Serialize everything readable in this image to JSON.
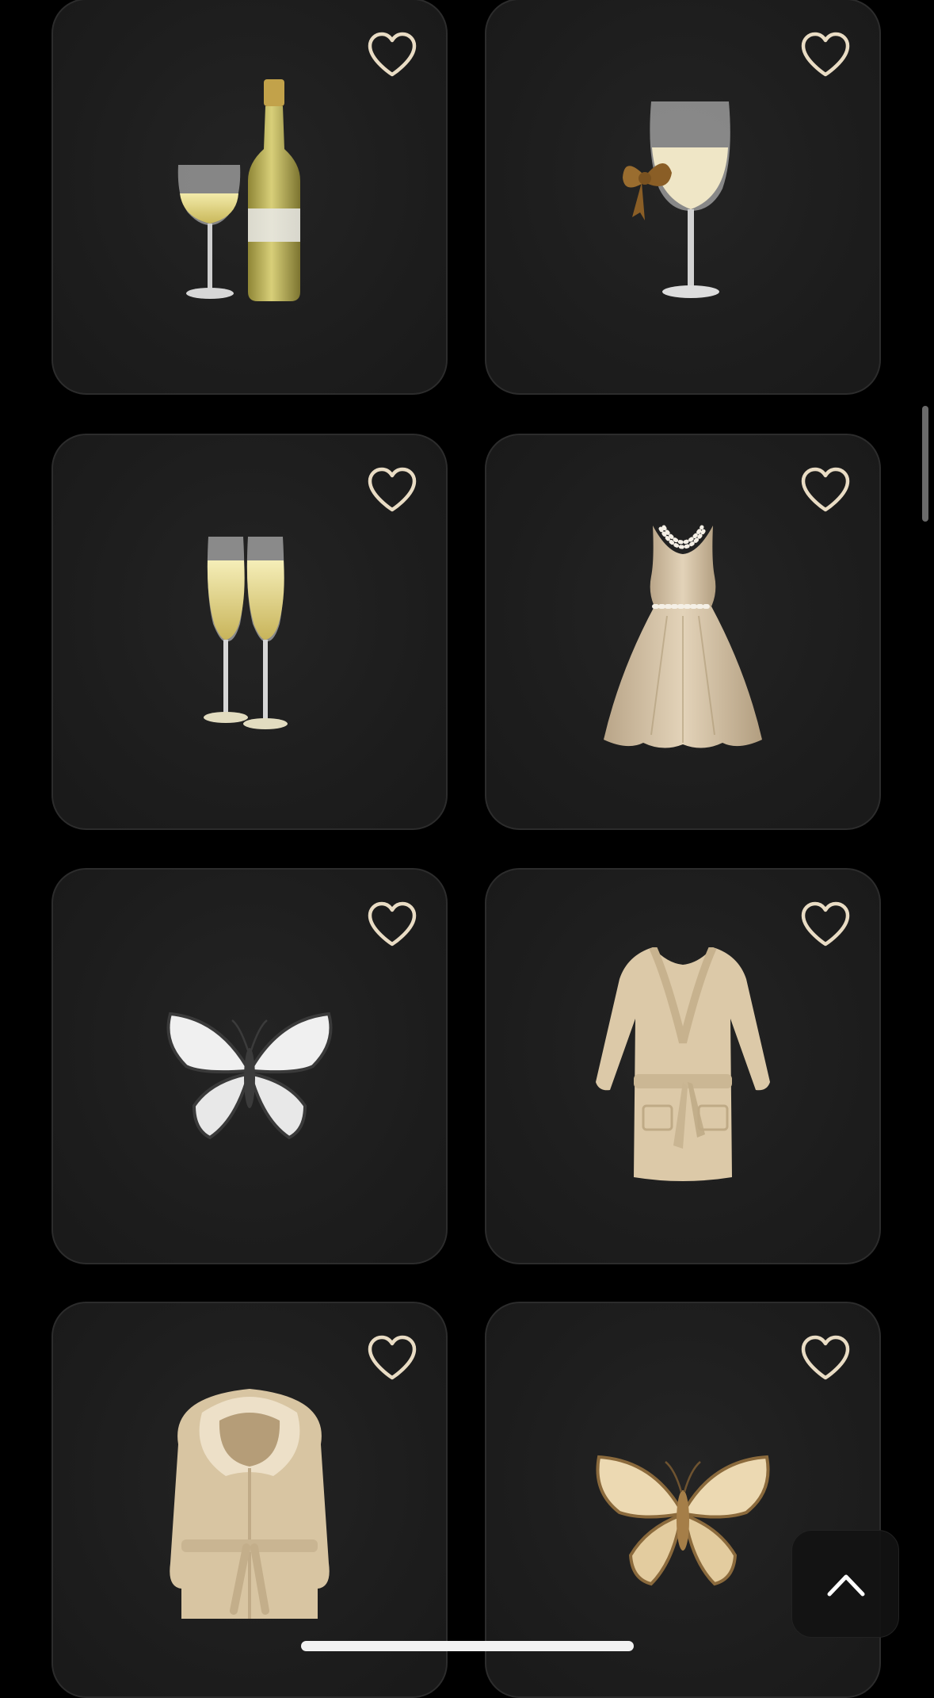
{
  "products": [
    {
      "item_icon": "wine-bottle-and-glass-icon",
      "favorite_icon": "heart-outline-icon",
      "favorited": false
    },
    {
      "item_icon": "wine-glass-with-bow-icon",
      "favorite_icon": "heart-outline-icon",
      "favorited": false
    },
    {
      "item_icon": "champagne-flutes-icon",
      "favorite_icon": "heart-outline-icon",
      "favorited": false
    },
    {
      "item_icon": "pearl-dress-icon",
      "favorite_icon": "heart-outline-icon",
      "favorited": false
    },
    {
      "item_icon": "white-butterfly-icon",
      "favorite_icon": "heart-outline-icon",
      "favorited": false
    },
    {
      "item_icon": "bathrobe-icon",
      "favorite_icon": "heart-outline-icon",
      "favorited": false
    },
    {
      "item_icon": "hooded-fur-robe-icon",
      "favorite_icon": "heart-outline-icon",
      "favorited": false
    },
    {
      "item_icon": "beige-butterfly-icon",
      "favorite_icon": "heart-outline-icon",
      "favorited": false
    }
  ],
  "controls": {
    "scroll_to_top_icon": "chevron-up-icon"
  },
  "colors": {
    "background": "#000000",
    "card": "#1e1e1e",
    "heart_outline": "#e9dcc4",
    "beige": "#d9c6a4"
  }
}
